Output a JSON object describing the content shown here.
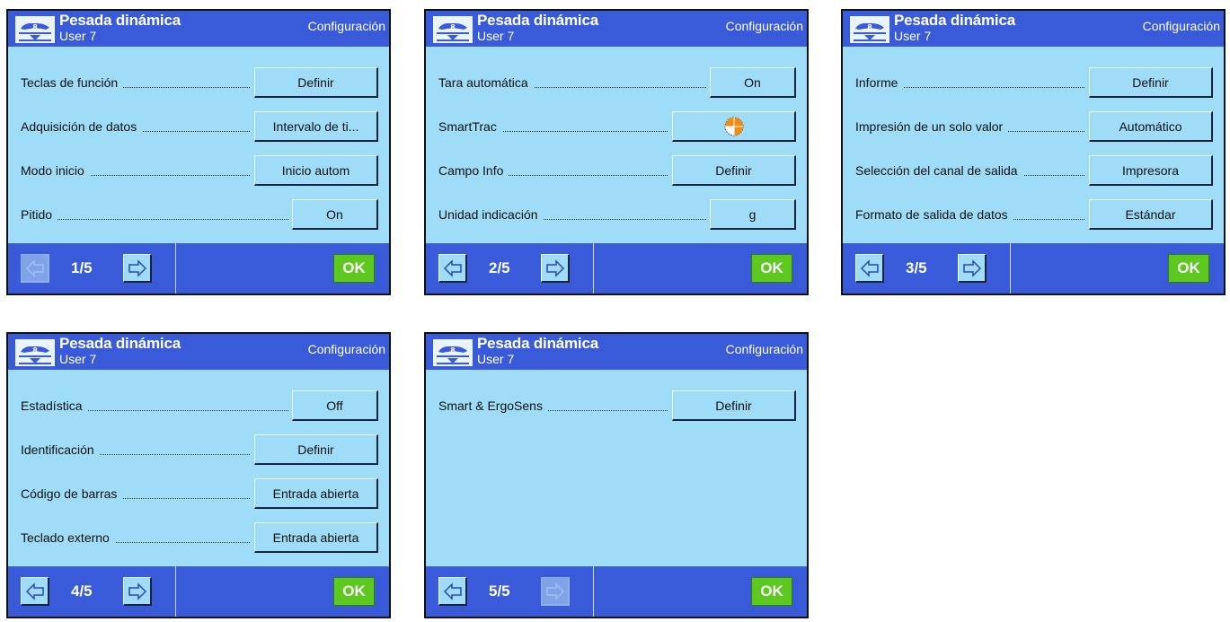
{
  "colors": {
    "header": "#3a5bd9",
    "panel": "#9fdcf8",
    "ok": "#5dc81e"
  },
  "screens": [
    {
      "title": "Pesada dinámica",
      "user": "User 7",
      "mode": "Configuración",
      "page": "1/5",
      "rows": [
        {
          "label": "Teclas de función",
          "value": "Definir"
        },
        {
          "label": "Adquisición de datos",
          "value": "Intervalo de ti..."
        },
        {
          "label": "Modo inicio",
          "value": "Inicio autom"
        },
        {
          "label": "Pitido",
          "value": "On"
        }
      ],
      "ok": "OK"
    },
    {
      "title": "Pesada dinámica",
      "user": "User 7",
      "mode": "Configuración",
      "page": "2/5",
      "rows": [
        {
          "label": "Tara automática",
          "value": "On"
        },
        {
          "label": "SmartTrac",
          "value": "",
          "icon": "smarttrac-icon"
        },
        {
          "label": "Campo Info",
          "value": "Definir"
        },
        {
          "label": "Unidad indicación",
          "value": "g"
        }
      ],
      "ok": "OK"
    },
    {
      "title": "Pesada dinámica",
      "user": "User 7",
      "mode": "Configuración",
      "page": "3/5",
      "rows": [
        {
          "label": "Informe",
          "value": "Definir"
        },
        {
          "label": "Impresión de un solo valor",
          "value": "Automático"
        },
        {
          "label": "Selección del canal de salida",
          "value": "Impresora"
        },
        {
          "label": "Formato de salida de datos",
          "value": "Estándar"
        }
      ],
      "ok": "OK"
    },
    {
      "title": "Pesada dinámica",
      "user": "User 7",
      "mode": "Configuración",
      "page": "4/5",
      "rows": [
        {
          "label": "Estadística",
          "value": "Off"
        },
        {
          "label": "Identificación",
          "value": "Definir"
        },
        {
          "label": "Código de barras",
          "value": "Entrada abierta"
        },
        {
          "label": "Teclado externo",
          "value": "Entrada abierta"
        }
      ],
      "ok": "OK"
    },
    {
      "title": "Pesada dinámica",
      "user": "User 7",
      "mode": "Configuración",
      "page": "5/5",
      "rows": [
        {
          "label": "Smart & ErgoSens",
          "value": "Definir"
        }
      ],
      "ok": "OK"
    }
  ]
}
